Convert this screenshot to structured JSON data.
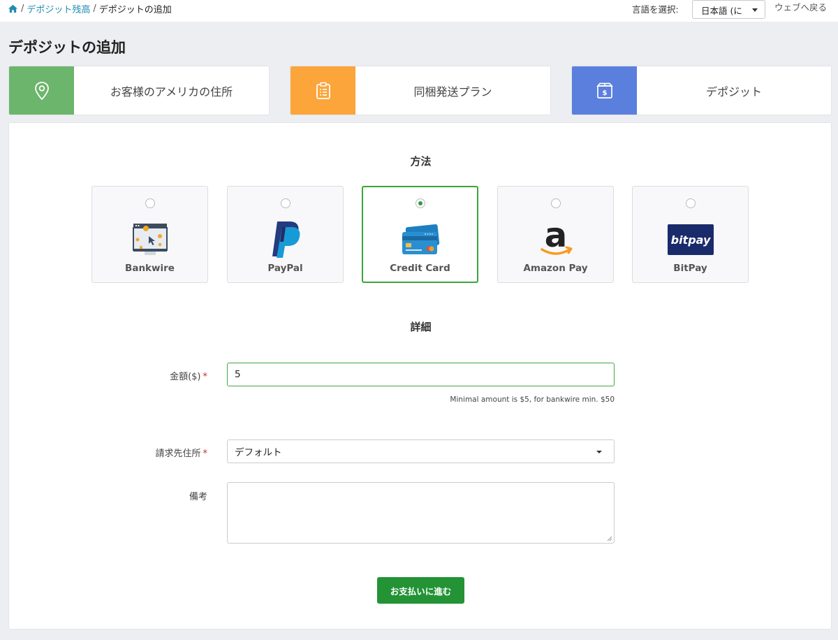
{
  "breadcrumb": {
    "home_icon": "home-icon",
    "link1": "デポジット残高",
    "current": "デポジットの追加",
    "separator": "/"
  },
  "header": {
    "language_label": "言語を選択:",
    "language_value": "日本語 (に",
    "back_label": "ウェブへ戻る"
  },
  "page_title": "デポジットの追加",
  "steps": [
    {
      "label": "お客様のアメリカの住所",
      "icon": "map-pin-icon",
      "color": "#6cb56c"
    },
    {
      "label": "同梱発送プラン",
      "icon": "clipboard-list-icon",
      "color": "#fca53a"
    },
    {
      "label": "デポジット",
      "icon": "box-dollar-icon",
      "color": "#5b7fdd"
    }
  ],
  "method_section_title": "方法",
  "methods": [
    {
      "name": "Bankwire",
      "icon": "bank-wire-icon",
      "selected": false
    },
    {
      "name": "PayPal",
      "icon": "paypal-icon",
      "selected": false
    },
    {
      "name": "Credit Card",
      "icon": "credit-card-icon",
      "selected": true
    },
    {
      "name": "Amazon Pay",
      "icon": "amazon-icon",
      "selected": false
    },
    {
      "name": "BitPay",
      "icon": "bitpay-icon",
      "selected": false,
      "logo_text": "bitpay"
    }
  ],
  "details_section_title": "詳細",
  "form": {
    "amount_label": "金額($)",
    "amount_value": "5",
    "amount_hint": "Minimal amount is $5, for bankwire min. $50",
    "billing_label": "請求先住所",
    "billing_value": "デフォルト",
    "notes_label": "備考",
    "notes_value": "",
    "required_mark": "*",
    "submit_label": "お支払いに進む"
  },
  "colors": {
    "accent_green": "#239335",
    "link": "#1f8db0",
    "required": "#d0242b"
  }
}
